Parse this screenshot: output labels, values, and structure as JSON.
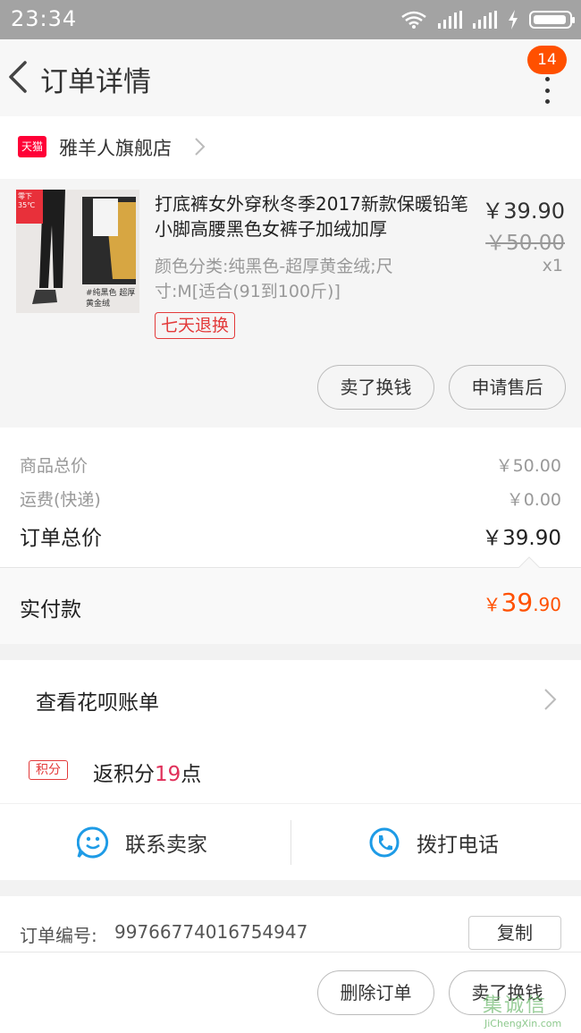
{
  "status_bar": {
    "time": "23:34"
  },
  "nav": {
    "title": "订单详情",
    "badge_count": "14"
  },
  "store": {
    "platform_tag": "天猫",
    "name": "雅羊人旗舰店"
  },
  "product": {
    "image_tag": "零下35℃",
    "image_caption": "#纯黑色 超厚黄金绒",
    "title": "打底裤女外穿秋冬季2017新款保暖铅笔小脚高腰黑色女裤子加绒加厚",
    "spec": "颜色分类:纯黑色-超厚黄金绒;尺寸:M[适合(91到100斤)]",
    "return_tag": "七天退换",
    "price": "￥39.90",
    "original_price": "￥50.00",
    "quantity": "x1",
    "sell_button": "卖了换钱",
    "aftersale_button": "申请售后"
  },
  "summary": {
    "goods_label": "商品总价",
    "goods_value": "￥50.00",
    "shipping_label": "运费(快递)",
    "shipping_value": "￥0.00",
    "total_label": "订单总价",
    "total_value": "￥39.90"
  },
  "payment": {
    "label": "实付款",
    "currency": "￥",
    "amount_int": "39",
    "amount_dec": ".90"
  },
  "huabei": {
    "label": "查看花呗账单"
  },
  "points": {
    "tag": "积分",
    "prefix": "返积分",
    "count": "19",
    "suffix": "点"
  },
  "contact": {
    "seller_label": "联系卖家",
    "phone_label": "拨打电话"
  },
  "order": {
    "number_label": "订单编号:",
    "number": "99766774016754947",
    "copy_button": "复制"
  },
  "actions": {
    "delete_button": "删除订单",
    "sell_button": "卖了换钱"
  },
  "watermark": {
    "text_cn": "JiChengXin",
    "text_cn_main": "集诚信",
    "text_url": "JiChengXin.com"
  },
  "colors": {
    "accent": "#ff5000",
    "tmall_red": "#ff0036",
    "contact_blue": "#1e9be6",
    "points_pink": "#e0305a"
  }
}
